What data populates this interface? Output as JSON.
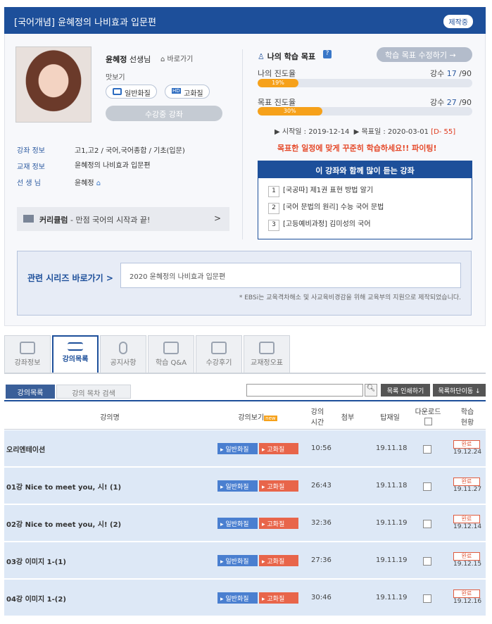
{
  "header": {
    "title": "[국어개념] 윤혜정의 나비효과 입문편",
    "badge": "제작중"
  },
  "teacher": {
    "name": "윤혜정",
    "suffix": " 선생님",
    "goto": "바로가기",
    "preview_label": "맛보기",
    "quality_normal": "일반화질",
    "quality_high": "고화질",
    "enrolled_button": "수강중 강좌"
  },
  "course_info": {
    "lecture_label": "강좌 정보",
    "lecture_value": "고1,고2 / 국어,국어종합 / 기초(입문)",
    "book_label": "교재 정보",
    "book_value": "윤혜정의 나비효과 입문편",
    "teacher_label": "선 생 님",
    "teacher_value": "윤혜정"
  },
  "curriculum": {
    "title": "커리큘럼",
    "desc": " - 만점 국어의 시작과 끝!",
    "arrow": ">"
  },
  "goal": {
    "title": "나의 학습 목표",
    "edit_button": "학습 목표 수정하기",
    "my_progress_label": "나의 진도율",
    "my_progress_pct": 19,
    "my_progress_text": "19%",
    "my_count": "17",
    "my_total": "90",
    "target_progress_label": "목표 진도율",
    "target_progress_pct": 30,
    "target_progress_text": "30%",
    "target_count": "27",
    "target_total": "90",
    "count_prefix": "강수 ",
    "count_sep": " /",
    "start": "▶ 시작일 : 2019-12-14",
    "end": "▶ 목표일 : 2020-03-01",
    "dday": "[D- 55]",
    "cheer": "목표한 일정에 맞게 꾸준히 학습하세요!! 파이팅!"
  },
  "recommend": {
    "title": "이 강좌와 함께 많이 듣는 강좌",
    "items": [
      {
        "num": "1",
        "label": "[국공따] 제1권 표현 방법 알기"
      },
      {
        "num": "2",
        "label": "[국어 문법의 원리] 수능 국어 문법"
      },
      {
        "num": "3",
        "label": "[고등예비과정] 김미성의 국어"
      }
    ]
  },
  "series": {
    "link": "관련 시리즈 바로가기 >",
    "item": "2020 윤혜정의 나비효과 입문편",
    "note": "* EBSi는 교육격차해소 및 사교육비경감을 위해 교육부의 지원으로 제작되었습니다."
  },
  "tabs": [
    "강좌정보",
    "강의목록",
    "공지사항",
    "학습 Q&A",
    "수강후기",
    "교재정오표"
  ],
  "list": {
    "tab_active": "강의목록",
    "tab_search": "강의 목차 검색",
    "print_button": "목록 인쇄하기",
    "download_button": "목록하단이동 ↓",
    "headers": {
      "name": "강의명",
      "view": "강의보기",
      "new": "new",
      "time": "강의\n시간",
      "attach": "첨부",
      "date": "탑재일",
      "download": "다운로드",
      "status": "학습\n현황"
    },
    "rows": [
      {
        "name": "오리엔테이션",
        "normal": "일반화질",
        "high": "고화질",
        "time": "10:56",
        "date": "19.11.18",
        "done": "완료",
        "done_date": "19.12.24"
      },
      {
        "name": "01강 Nice to meet you, 시! (1)",
        "normal": "일반화질",
        "high": "고화질",
        "time": "26:43",
        "date": "19.11.18",
        "done": "완료",
        "done_date": "19.11.27"
      },
      {
        "name": "02강 Nice to meet you, 시! (2)",
        "normal": "일반화질",
        "high": "고화질",
        "time": "32:36",
        "date": "19.11.19",
        "done": "완료",
        "done_date": "19.12.14"
      },
      {
        "name": "03강 이미지 1-(1)",
        "normal": "일반화질",
        "high": "고화질",
        "time": "27:36",
        "date": "19.11.19",
        "done": "완료",
        "done_date": "19.12.15"
      },
      {
        "name": "04강 이미지 1-(2)",
        "normal": "일반화질",
        "high": "고화질",
        "time": "30:46",
        "date": "19.11.19",
        "done": "완료",
        "done_date": "19.12.16"
      }
    ]
  }
}
